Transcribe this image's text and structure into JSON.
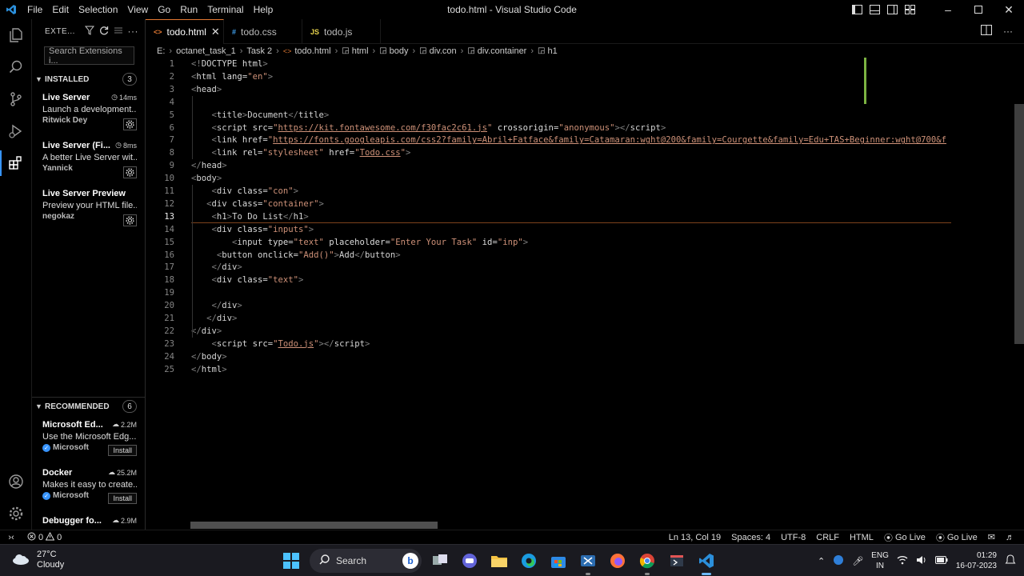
{
  "window": {
    "title": "todo.html - Visual Studio Code",
    "menu": [
      "File",
      "Edit",
      "Selection",
      "View",
      "Go",
      "Run",
      "Terminal",
      "Help"
    ]
  },
  "sidebar": {
    "title": "EXTE...",
    "search_placeholder": "Search Extensions i...",
    "installed": {
      "label": "INSTALLED",
      "count": "3",
      "items": [
        {
          "name": "Live Server",
          "meta": "14ms",
          "desc": "Launch a development...",
          "publisher": "Ritwick Dey"
        },
        {
          "name": "Live Server (Fi...",
          "meta": "8ms",
          "desc": "A better Live Server wit...",
          "publisher": "Yannick"
        },
        {
          "name": "Live Server Preview",
          "meta": "",
          "desc": "Preview your HTML file...",
          "publisher": "negokaz"
        }
      ]
    },
    "recommended": {
      "label": "RECOMMENDED",
      "count": "6",
      "items": [
        {
          "name": "Microsoft Ed...",
          "meta": "2.2M",
          "desc": "Use the Microsoft Edg...",
          "publisher": "Microsoft",
          "action": "Install"
        },
        {
          "name": "Docker",
          "meta": "25.2M",
          "desc": "Makes it easy to create...",
          "publisher": "Microsoft",
          "action": "Install"
        },
        {
          "name": "Debugger fo...",
          "meta": "2.9M",
          "desc": "",
          "publisher": "",
          "action": ""
        }
      ]
    }
  },
  "tabs": [
    {
      "label": "todo.html",
      "icon": "<>",
      "active": true
    },
    {
      "label": "todo.css",
      "icon": "#",
      "active": false
    },
    {
      "label": "todo.js",
      "icon": "JS",
      "active": false
    }
  ],
  "breadcrumb": [
    "E:",
    "octanet_task_1",
    "Task 2",
    "todo.html",
    "html",
    "body",
    "div.con",
    "div.container",
    "h1"
  ],
  "editor": {
    "current_line": 13,
    "lines": [
      {
        "n": "1",
        "html": "<span class='t'>&lt;!</span><span class='tg'>DOCTYPE</span> <span class='at'>html</span><span class='t'>&gt;</span>"
      },
      {
        "n": "2",
        "html": "<span class='t'>&lt;</span><span class='tg'>html</span> <span class='at'>lang</span>=<span class='sv'>\"en\"</span><span class='t'>&gt;</span>"
      },
      {
        "n": "3",
        "html": "<span class='t'>&lt;</span><span class='tg'>head</span><span class='t'>&gt;</span>"
      },
      {
        "n": "4",
        "html": ""
      },
      {
        "n": "5",
        "html": "    <span class='t'>&lt;</span><span class='tg'>title</span><span class='t'>&gt;</span>Document<span class='t'>&lt;/</span><span class='tg'>title</span><span class='t'>&gt;</span>"
      },
      {
        "n": "6",
        "html": "    <span class='t'>&lt;</span><span class='tg'>script</span> <span class='at'>src</span>=<span class='sv'>\"</span><span class='url'>https://kit.fontawesome.com/f30fac2c61.js</span><span class='sv'>\"</span> <span class='at'>crossorigin</span>=<span class='sv'>\"anonymous\"</span><span class='t'>&gt;&lt;/</span><span class='tg'>script</span><span class='t'>&gt;</span>"
      },
      {
        "n": "7",
        "html": "    <span class='t'>&lt;</span><span class='tg'>link</span> <span class='at'>href</span>=<span class='sv'>\"</span><span class='url'>https://fonts.googleapis.com/css2?family=Abril+Fatface&amp;family=Catamaran:wght@200&amp;family=Courgette&amp;family=Edu+TAS+Beginner:wght@700&amp;f</span>"
      },
      {
        "n": "8",
        "html": "    <span class='t'>&lt;</span><span class='tg'>link</span> <span class='at'>rel</span>=<span class='sv'>\"stylesheet\"</span> <span class='at'>href</span>=<span class='sv'>\"</span><span class='url'>Todo.css</span><span class='sv'>\"</span><span class='t'>&gt;</span>"
      },
      {
        "n": "9",
        "html": "<span class='t'>&lt;/</span><span class='tg'>head</span><span class='t'>&gt;</span>"
      },
      {
        "n": "10",
        "html": "<span class='t'>&lt;</span><span class='tg'>body</span><span class='t'>&gt;</span>"
      },
      {
        "n": "11",
        "html": "    <span class='t'>&lt;</span><span class='tg'>div</span> <span class='at'>class</span>=<span class='sv'>\"con\"</span><span class='t'>&gt;</span>"
      },
      {
        "n": "12",
        "html": "   <span class='t'>&lt;</span><span class='tg'>div</span> <span class='at'>class</span>=<span class='sv'>\"container\"</span><span class='t'>&gt;</span>"
      },
      {
        "n": "13",
        "html": "    <span class='t'>&lt;</span><span class='tg'>h1</span><span class='t'>&gt;</span>To Do List<span class='t'>&lt;/</span><span class='tg'>h1</span><span class='t'>&gt;</span>"
      },
      {
        "n": "14",
        "html": "    <span class='t'>&lt;</span><span class='tg'>div</span> <span class='at'>class</span>=<span class='sv'>\"inputs\"</span><span class='t'>&gt;</span>"
      },
      {
        "n": "15",
        "html": "        <span class='t'>&lt;</span><span class='tg'>input</span> <span class='at'>type</span>=<span class='sv'>\"text\"</span> <span class='at'>placeholder</span>=<span class='sv'>\"Enter Your Task\"</span> <span class='at'>id</span>=<span class='sv'>\"inp\"</span><span class='t'>&gt;</span>"
      },
      {
        "n": "16",
        "html": "     <span class='t'>&lt;</span><span class='tg'>button</span> <span class='at'>onclick</span>=<span class='sv'>\"Add()\"</span><span class='t'>&gt;</span>Add<span class='t'>&lt;/</span><span class='tg'>button</span><span class='t'>&gt;</span>"
      },
      {
        "n": "17",
        "html": "    <span class='t'>&lt;/</span><span class='tg'>div</span><span class='t'>&gt;</span>"
      },
      {
        "n": "18",
        "html": "    <span class='t'>&lt;</span><span class='tg'>div</span> <span class='at'>class</span>=<span class='sv'>\"text\"</span><span class='t'>&gt;</span>"
      },
      {
        "n": "19",
        "html": ""
      },
      {
        "n": "20",
        "html": "    <span class='t'>&lt;/</span><span class='tg'>div</span><span class='t'>&gt;</span>"
      },
      {
        "n": "21",
        "html": "   <span class='t'>&lt;/</span><span class='tg'>div</span><span class='t'>&gt;</span>"
      },
      {
        "n": "22",
        "html": "<span class='t'>&lt;/</span><span class='tg'>div</span><span class='t'>&gt;</span>"
      },
      {
        "n": "23",
        "html": "    <span class='t'>&lt;</span><span class='tg'>script</span> <span class='at'>src</span>=<span class='sv'>\"</span><span class='url'>Todo.js</span><span class='sv'>\"</span><span class='t'>&gt;&lt;/</span><span class='tg'>script</span><span class='t'>&gt;</span>"
      },
      {
        "n": "24",
        "html": "<span class='t'>&lt;/</span><span class='tg'>body</span><span class='t'>&gt;</span>"
      },
      {
        "n": "25",
        "html": "<span class='t'>&lt;/</span><span class='tg'>html</span><span class='t'>&gt;</span>"
      }
    ]
  },
  "status": {
    "errors": "0",
    "warnings": "0",
    "position": "Ln 13, Col 19",
    "spaces": "Spaces: 4",
    "encoding": "UTF-8",
    "eol": "CRLF",
    "language": "HTML",
    "go_live_1": "Go Live",
    "go_live_2": "Go Live"
  },
  "taskbar": {
    "temp": "27°C",
    "weather": "Cloudy",
    "search": "Search",
    "lang1": "ENG",
    "lang2": "IN",
    "time": "01:29",
    "date": "16-07-2023"
  },
  "colors": {
    "accent": "#e37933",
    "tag": "#808080",
    "string": "#ce9178",
    "activity_indicator": "#3794ff"
  }
}
